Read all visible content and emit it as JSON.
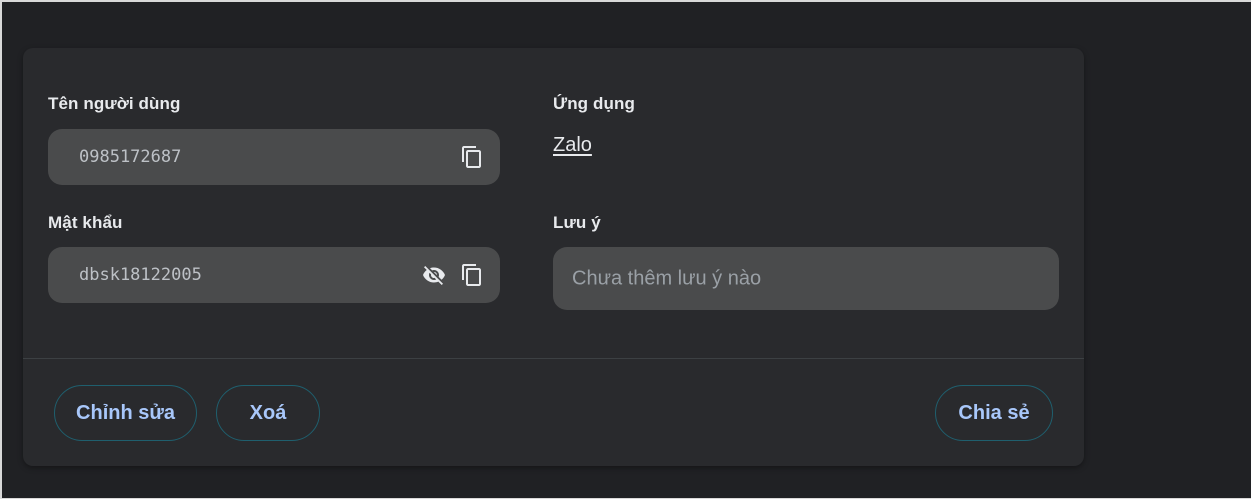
{
  "credential": {
    "username_label": "Tên người dùng",
    "username_value": "0985172687",
    "password_label": "Mật khẩu",
    "password_value": "dbsk18122005",
    "app_label": "Ứng dụng",
    "app_value": "Zalo",
    "note_label": "Lưu ý",
    "note_placeholder": "Chưa thêm lưu ý nào"
  },
  "actions": {
    "edit_label": "Chỉnh sửa",
    "delete_label": "Xoá",
    "share_label": "Chia sẻ"
  },
  "icons": {
    "copy": "copy-icon",
    "visibility": "eye-off-icon"
  },
  "colors": {
    "background": "#202124",
    "card": "#292a2d",
    "field": "#4a4b4c",
    "button_text": "#a8c7fa",
    "button_border": "#1f5f6e"
  }
}
